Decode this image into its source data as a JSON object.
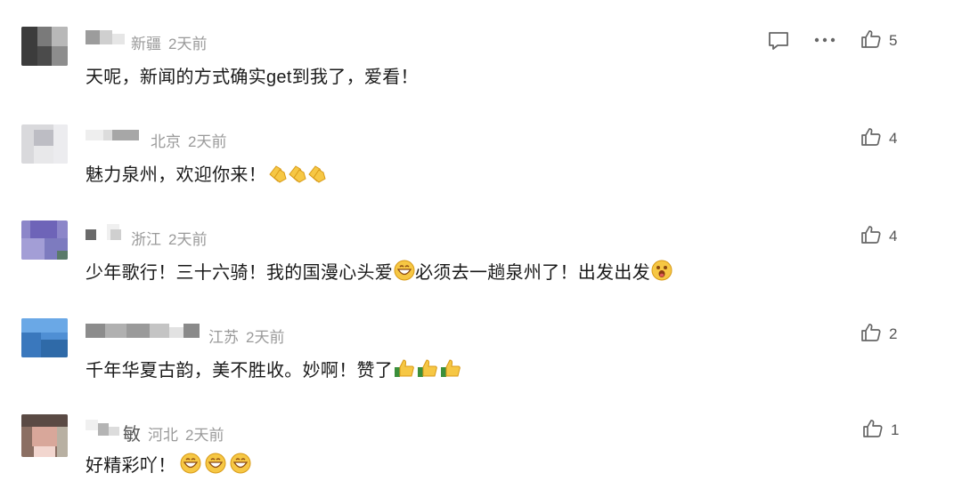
{
  "comments": [
    {
      "name": "",
      "region": "新疆",
      "time": "2天前",
      "text": "天呢，新闻的方式确实get到我了，爱看！",
      "likes": "5"
    },
    {
      "name": "",
      "region": "北京",
      "time": "2天前",
      "text": "魅力泉州，欢迎你来！",
      "likes": "4"
    },
    {
      "name": "",
      "region": "浙江",
      "time": "2天前",
      "text": "少年歌行！三十六骑！我的国漫心头爱",
      "text2": "必须去一趟泉州了！出发出发",
      "likes": "4"
    },
    {
      "name": "",
      "region": "江苏",
      "time": "2天前",
      "text": "千年华夏古韵，美不胜收。妙啊！赞了",
      "likes": "2"
    },
    {
      "name": "敏",
      "region": "河北",
      "time": "2天前",
      "text": "好精彩吖！",
      "likes": "1"
    }
  ],
  "icons": {
    "reply": "speech-bubble-icon",
    "more": "ellipsis-icon",
    "like": "thumbs-up-icon"
  },
  "colors": {
    "meta": "#9a9a9a",
    "text": "#1a1a1a",
    "icon": "#666666"
  }
}
